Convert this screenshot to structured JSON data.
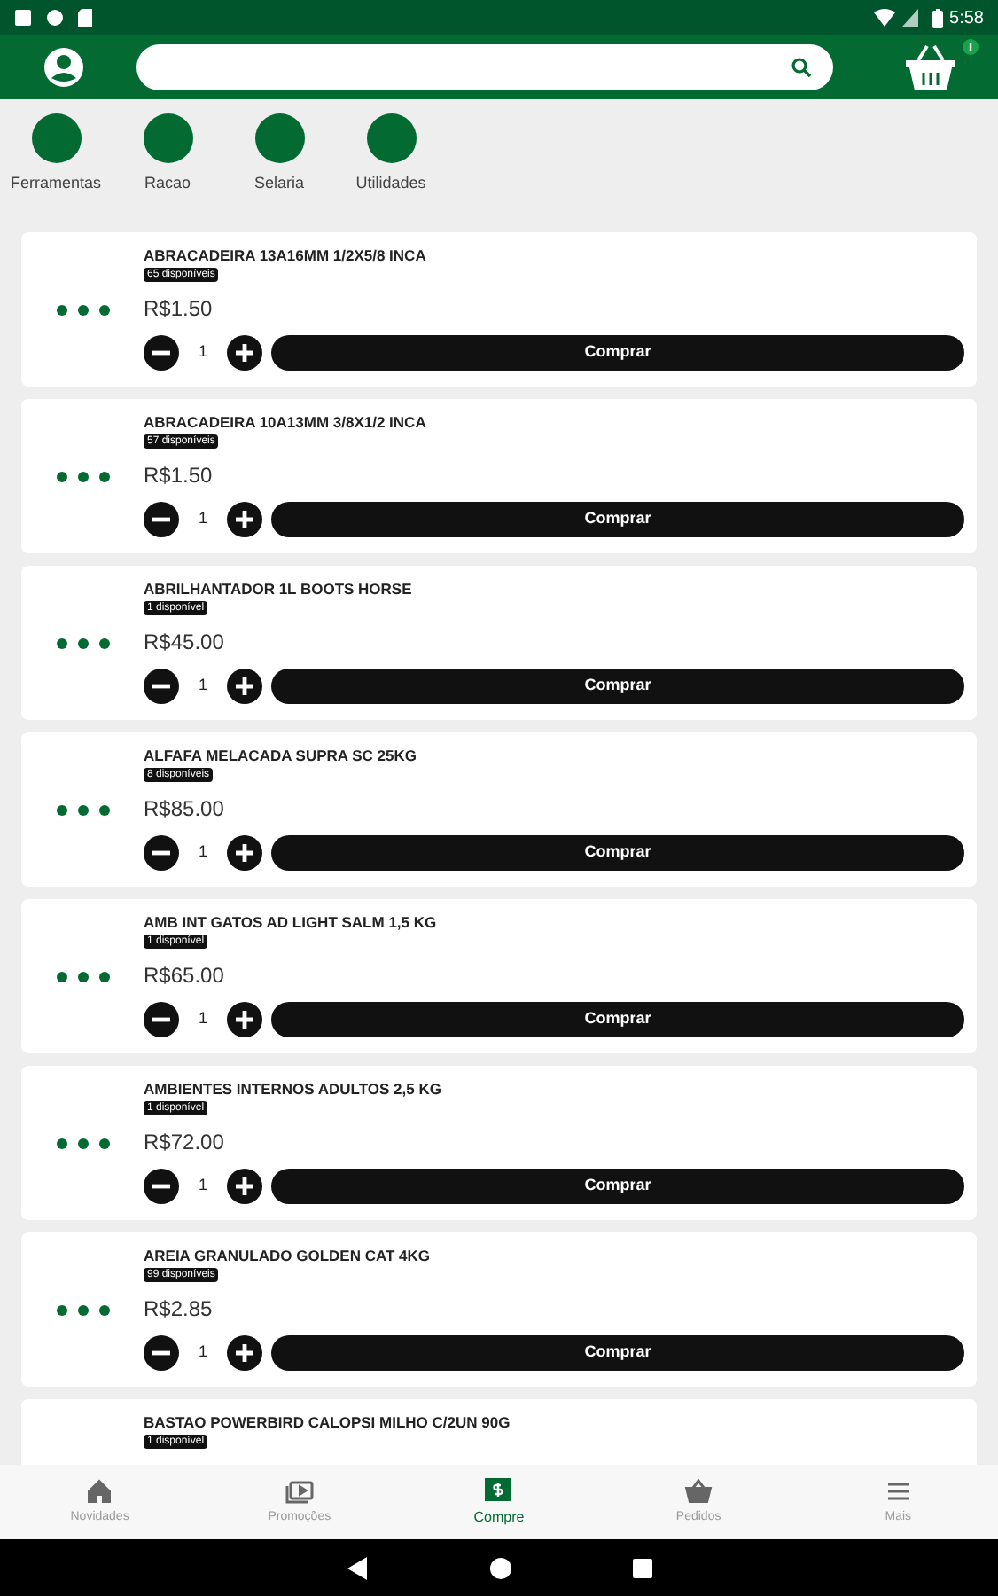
{
  "status_bar": {
    "time": "5:58"
  },
  "categories": [
    {
      "label": "Ferramentas"
    },
    {
      "label": "Racao"
    },
    {
      "label": "Selaria"
    },
    {
      "label": "Utilidades"
    }
  ],
  "products": [
    {
      "name": "ABRACADEIRA 13A16MM 1/2X5/8  INCA",
      "stock": "65 disponíveis",
      "price": "R$1.50",
      "quantity": "1",
      "button": "Comprar"
    },
    {
      "name": "ABRACADEIRA 10A13MM 3/8X1/2 INCA",
      "stock": "57 disponíveis",
      "price": "R$1.50",
      "quantity": "1",
      "button": "Comprar"
    },
    {
      "name": "ABRILHANTADOR 1L BOOTS HORSE",
      "stock": "1 disponível",
      "price": "R$45.00",
      "quantity": "1",
      "button": "Comprar"
    },
    {
      "name": "ALFAFA MELACADA SUPRA SC 25KG",
      "stock": "8 disponíveis",
      "price": "R$85.00",
      "quantity": "1",
      "button": "Comprar"
    },
    {
      "name": "AMB INT GATOS AD LIGHT SALM 1,5 KG",
      "stock": "1 disponível",
      "price": "R$65.00",
      "quantity": "1",
      "button": "Comprar"
    },
    {
      "name": "AMBIENTES INTERNOS ADULTOS 2,5 KG",
      "stock": "1 disponível",
      "price": "R$72.00",
      "quantity": "1",
      "button": "Comprar"
    },
    {
      "name": "AREIA GRANULADO GOLDEN CAT 4KG",
      "stock": "99 disponíveis",
      "price": "R$2.85",
      "quantity": "1",
      "button": "Comprar"
    },
    {
      "name": "BASTAO POWERBIRD CALOPSI MILHO C/2UN 90G",
      "stock": "1 disponível"
    }
  ],
  "bottom_nav": [
    {
      "kind": "home",
      "label": "Novidades",
      "selected": false
    },
    {
      "kind": "promo",
      "label": "Promoções",
      "selected": false
    },
    {
      "kind": "buy",
      "label": "Compre",
      "selected": true
    },
    {
      "kind": "orders",
      "label": "Pedidos",
      "selected": false
    },
    {
      "kind": "more",
      "label": "Mais",
      "selected": false
    }
  ]
}
